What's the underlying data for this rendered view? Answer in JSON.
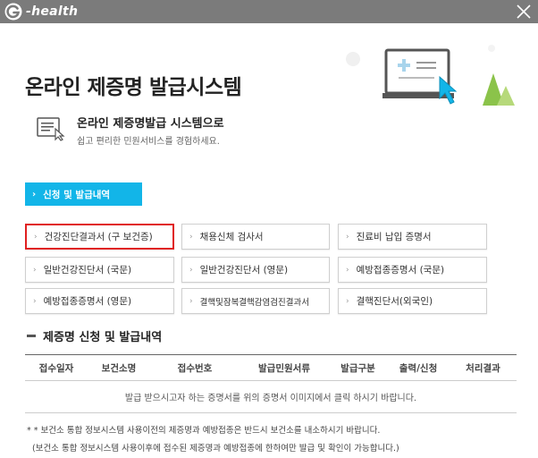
{
  "window": {
    "brand": "-health",
    "close_icon": "close-icon"
  },
  "hero": {
    "title": "온라인 제증명 발급시스템"
  },
  "intro": {
    "title": "온라인 제증명발급 시스템으로",
    "subtitle": "쉽고 편리한 민원서비스를 경험하세요."
  },
  "tab": {
    "label": "신청 및 발급내역",
    "accent": "#12b5e8"
  },
  "certificates": [
    {
      "label": "건강진단결과서 (구 보건증)",
      "highlighted": true
    },
    {
      "label": "채용신체 검사서",
      "highlighted": false
    },
    {
      "label": "진료비 납입 증명서",
      "highlighted": false
    },
    {
      "label": "일반건강진단서 (국문)",
      "highlighted": false
    },
    {
      "label": "일반건강진단서 (영문)",
      "highlighted": false
    },
    {
      "label": "예방접종증명서 (국문)",
      "highlighted": false
    },
    {
      "label": "예방접종증명서 (영문)",
      "highlighted": false
    },
    {
      "label": "결핵및잠복결핵감염검진결과서",
      "highlighted": false
    },
    {
      "label": "결핵진단서(외국인)",
      "highlighted": false
    }
  ],
  "history": {
    "title": "제증명 신청 및 발급내역",
    "columns": [
      "접수일자",
      "보건소명",
      "접수번호",
      "발급민원서류",
      "발급구분",
      "출력/신청",
      "처리결과"
    ],
    "empty_message": "발급 받으시고자 하는 증명서를 위의 증명서 이미지에서 클릭 하시기 바랍니다."
  },
  "notes": {
    "line1": "* * 보건소 통합 정보시스템 사용이전의 제증명과 예방접종은 반드시 보건소를 내소하시기 바랍니다.",
    "line2": "(보건소 통합 정보시스템 사용이후에 접수된 제증명과 예방접종에 한하여만 발급 및 확인이 가능합니다.)"
  },
  "colors": {
    "titlebar": "#7b7b7b",
    "highlight_border": "#e02020"
  }
}
